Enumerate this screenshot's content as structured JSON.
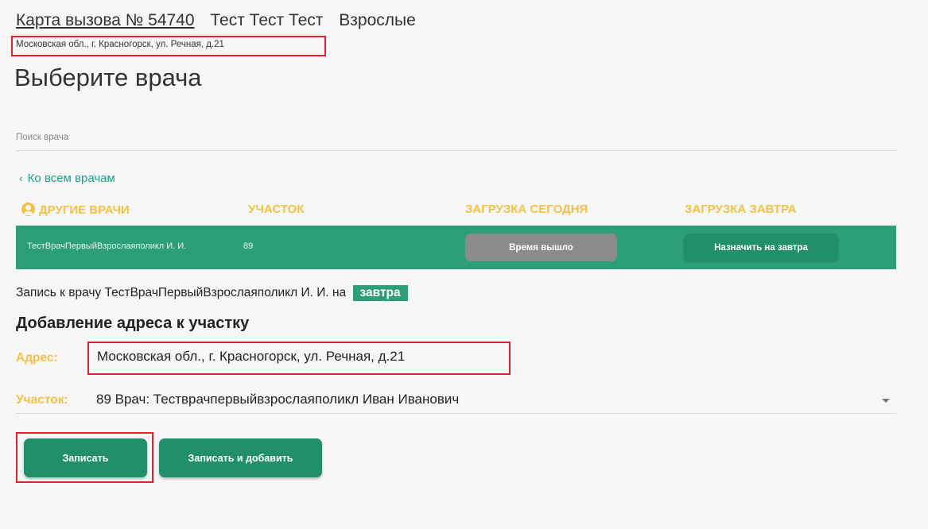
{
  "header": {
    "card_number": "Карта вызова № 54740",
    "patient_name": "Тест Тест Тест",
    "age_group": "Взрослые",
    "address": "Московская обл., г. Красногорск, ул. Речная, д.21"
  },
  "page_title": "Выберите врача",
  "search": {
    "placeholder": "Поиск врача",
    "value": ""
  },
  "back_link": "Ко всем врачам",
  "table": {
    "headers": {
      "doctors": "ДРУГИЕ ВРАЧИ",
      "district": "УЧАСТОК",
      "load_today": "ЗАГРУЗКА СЕГОДНЯ",
      "load_tomorrow": "ЗАГРУЗКА ЗАВТРА"
    },
    "rows": [
      {
        "doctor": "ТестВрачПервыйВзрослаяполикл И. И.",
        "district": "89",
        "today_button": "Время вышло",
        "tomorrow_button": "Назначить на завтра"
      }
    ]
  },
  "appointment": {
    "prefix": "Запись к врачу ТестВрачПервыйВзрослаяполикл И. И. на",
    "day": "завтра"
  },
  "add_address": {
    "title": "Добавление адреса к участку",
    "address_label": "Адрес:",
    "address_value": "Московская обл., г. Красногорск, ул. Речная, д.21",
    "district_label": "Участок:",
    "district_value": "89 Врач: Теcтврачпервыйвзрослаяполикл Иван Иванович"
  },
  "buttons": {
    "save": "Записать",
    "save_and_add": "Записать и добавить"
  },
  "colors": {
    "accent_green": "#2d9f77",
    "button_green": "#21906a",
    "header_yellow": "#f6c043",
    "highlight_red": "#e0202b",
    "disabled_gray": "#8b8b8b"
  }
}
